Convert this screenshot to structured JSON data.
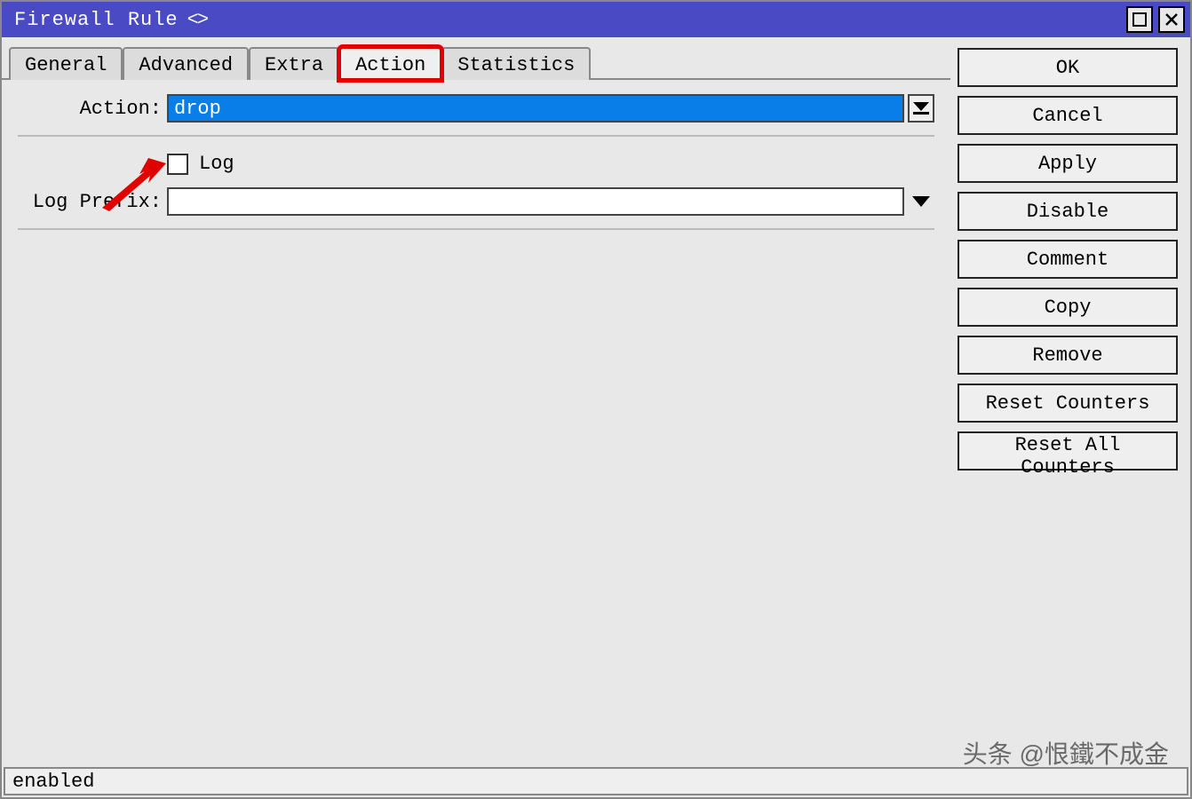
{
  "window": {
    "title": "Firewall Rule",
    "title_suffix": "<>"
  },
  "tabs": {
    "items": [
      {
        "label": "General"
      },
      {
        "label": "Advanced"
      },
      {
        "label": "Extra"
      },
      {
        "label": "Action",
        "active": true,
        "highlighted": true
      },
      {
        "label": "Statistics"
      }
    ]
  },
  "form": {
    "action_label": "Action:",
    "action_value": "drop",
    "log_label": "Log",
    "log_checked": false,
    "log_prefix_label": "Log Prefix:",
    "log_prefix_value": ""
  },
  "sidebar": {
    "ok": "OK",
    "cancel": "Cancel",
    "apply": "Apply",
    "disable": "Disable",
    "comment": "Comment",
    "copy": "Copy",
    "remove": "Remove",
    "reset_counters": "Reset Counters",
    "reset_all_counters": "Reset All Counters"
  },
  "status": {
    "text": "enabled"
  },
  "watermark": "头条 @恨鐵不成金"
}
